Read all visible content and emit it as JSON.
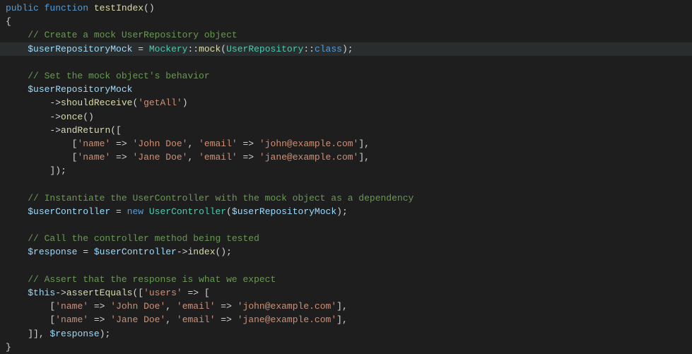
{
  "code": {
    "l01_kw1": "public",
    "l01_kw2": "function",
    "l01_fn": "testIndex",
    "l02_brace": "{",
    "l03_cmt": "// Create a mock UserRepository object",
    "l04_var": "$userRepositoryMock",
    "l04_op": " = ",
    "l04_cls1": "Mockery",
    "l04_op2": "::",
    "l04_fn": "mock",
    "l04_op3": "(",
    "l04_cls2": "UserRepository",
    "l04_op4": "::",
    "l04_kw": "class",
    "l04_op5": ");",
    "l06_cmt": "// Set the mock object's behavior",
    "l07_var": "$userRepositoryMock",
    "l08_arrow": "->",
    "l08_fn": "shouldReceive",
    "l08_op": "(",
    "l08_str": "'getAll'",
    "l08_op2": ")",
    "l09_arrow": "->",
    "l09_fn": "once",
    "l09_op": "()",
    "l10_arrow": "->",
    "l10_fn": "andReturn",
    "l10_op": "([",
    "l11_op": "[",
    "l11_str1": "'name'",
    "l11_arrow": " => ",
    "l11_str2": "'John Doe'",
    "l11_comma": ", ",
    "l11_str3": "'email'",
    "l11_arrow2": " => ",
    "l11_str4": "'john@example.com'",
    "l11_op2": "],",
    "l12_op": "[",
    "l12_str1": "'name'",
    "l12_arrow": " => ",
    "l12_str2": "'Jane Doe'",
    "l12_comma": ", ",
    "l12_str3": "'email'",
    "l12_arrow2": " => ",
    "l12_str4": "'jane@example.com'",
    "l12_op2": "],",
    "l13_op": "]);",
    "l15_cmt": "// Instantiate the UserController with the mock object as a dependency",
    "l16_var": "$userController",
    "l16_op": " = ",
    "l16_kw": "new",
    "l16_sp": " ",
    "l16_cls": "UserController",
    "l16_op2": "(",
    "l16_var2": "$userRepositoryMock",
    "l16_op3": ");",
    "l18_cmt": "// Call the controller method being tested",
    "l19_var": "$response",
    "l19_op": " = ",
    "l19_var2": "$userController",
    "l19_arrow": "->",
    "l19_fn": "index",
    "l19_op2": "();",
    "l21_cmt": "// Assert that the response is what we expect",
    "l22_var": "$this",
    "l22_arrow": "->",
    "l22_fn": "assertEquals",
    "l22_op": "([",
    "l22_str": "'users'",
    "l22_arrow2": " => ",
    "l22_op2": "[",
    "l23_op": "[",
    "l23_str1": "'name'",
    "l23_arrow": " => ",
    "l23_str2": "'John Doe'",
    "l23_comma": ", ",
    "l23_str3": "'email'",
    "l23_arrow2": " => ",
    "l23_str4": "'john@example.com'",
    "l23_op2": "],",
    "l24_op": "[",
    "l24_str1": "'name'",
    "l24_arrow": " => ",
    "l24_str2": "'Jane Doe'",
    "l24_comma": ", ",
    "l24_str3": "'email'",
    "l24_arrow2": " => ",
    "l24_str4": "'jane@example.com'",
    "l24_op2": "],",
    "l25_op": "]], ",
    "l25_var": "$response",
    "l25_op2": ");",
    "l26_brace": "}"
  }
}
